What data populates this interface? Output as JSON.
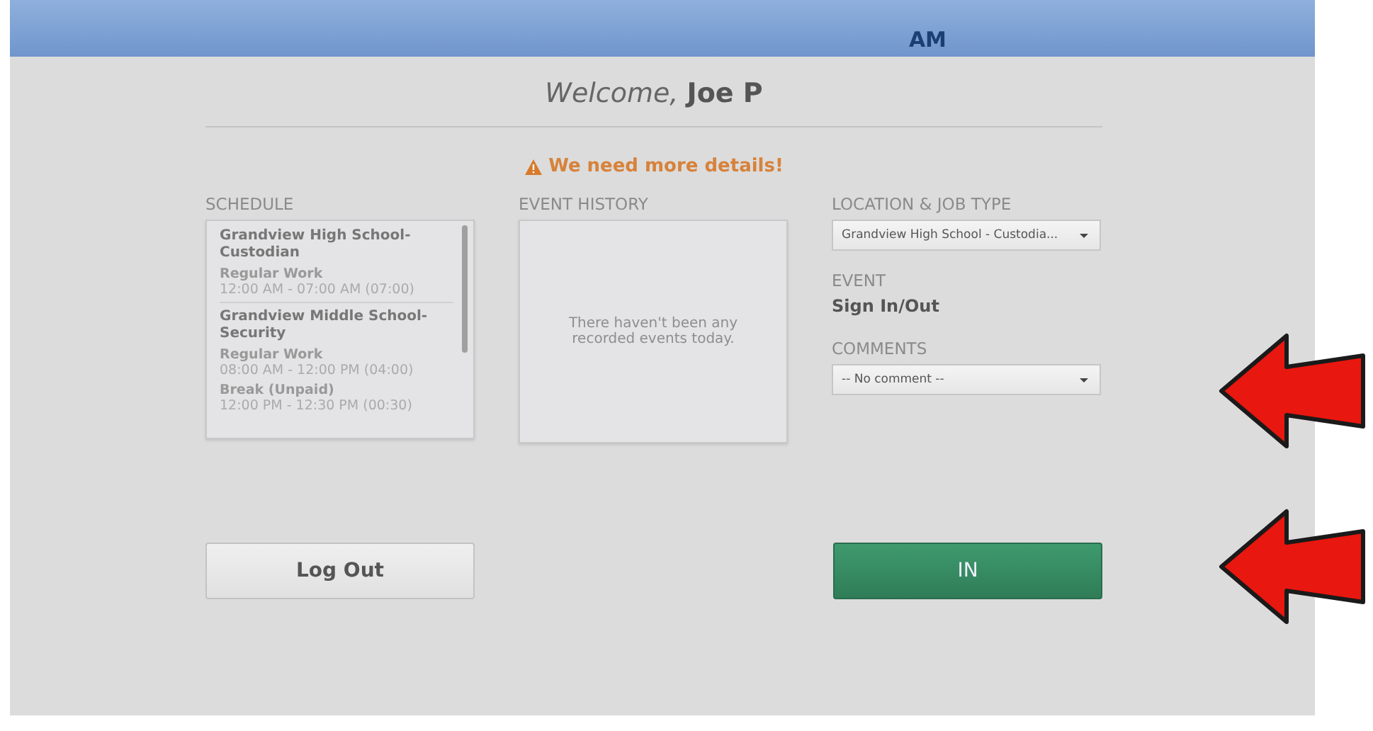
{
  "header": {
    "meridiem": "AM"
  },
  "welcome": {
    "greeting": "Welcome,",
    "name": "Joe P"
  },
  "alert": {
    "text": "We need more details!"
  },
  "schedule": {
    "label": "SCHEDULE",
    "entries": [
      {
        "kind": "job",
        "text": "Grandview High School-Custodian"
      },
      {
        "kind": "type",
        "text": "Regular Work"
      },
      {
        "kind": "time",
        "text": "12:00 AM - 07:00 AM (07:00)"
      },
      {
        "kind": "job",
        "text": "Grandview Middle School-Security"
      },
      {
        "kind": "type",
        "text": "Regular Work"
      },
      {
        "kind": "time",
        "text": "08:00 AM - 12:00 PM (04:00)"
      },
      {
        "kind": "type",
        "text": "Break (Unpaid)"
      },
      {
        "kind": "time",
        "text": "12:00 PM - 12:30 PM (00:30)"
      }
    ]
  },
  "event_history": {
    "label": "EVENT HISTORY",
    "empty_text": "There haven't been any recorded events today."
  },
  "location": {
    "label": "LOCATION & JOB TYPE",
    "value": "Grandview High School - Custodia..."
  },
  "event": {
    "label": "EVENT",
    "value": "Sign In/Out"
  },
  "comments": {
    "label": "COMMENTS",
    "value": "-- No comment --"
  },
  "buttons": [
    {
      "kind": "secondary",
      "label": "Log Out"
    },
    {
      "kind": "primary",
      "label": "IN"
    }
  ],
  "annotations": [
    {
      "kind": "arrow"
    },
    {
      "kind": "arrow"
    }
  ]
}
